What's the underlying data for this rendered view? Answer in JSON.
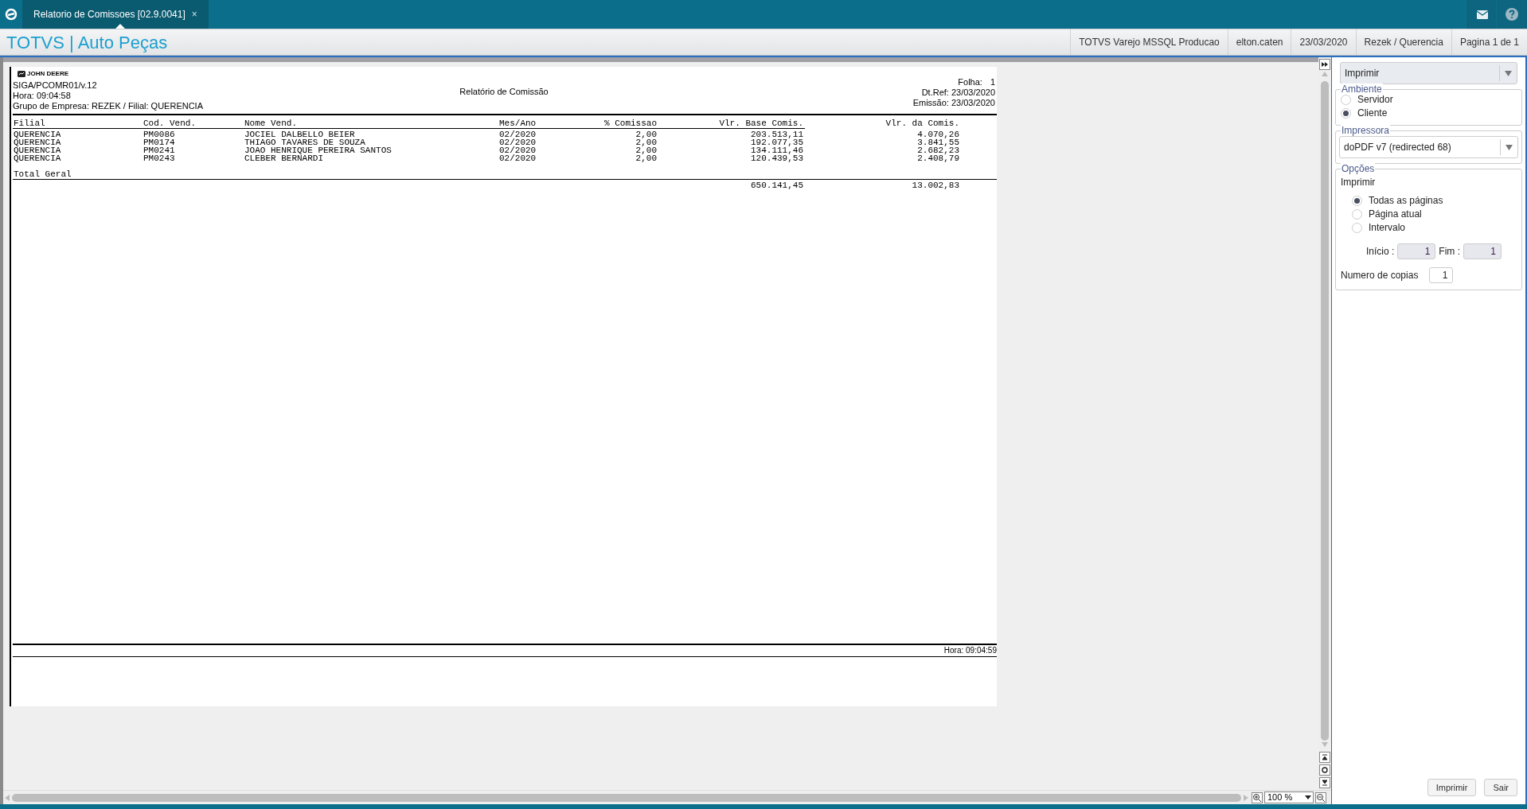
{
  "app_bar": {
    "tab": {
      "label": "Relatorio de Comissoes [02.9.0041]",
      "close": "×",
      "selected": true
    }
  },
  "header": {
    "title": "TOTVS | Auto Peças",
    "info": [
      "TOTVS Varejo MSSQL Producao",
      "elton.caten",
      "23/03/2020",
      "Rezek / Querencia",
      "Pagina 1 de 1"
    ]
  },
  "report": {
    "logo": "JOHN DEERE",
    "program": "SIGA/PCOMR01/v.12",
    "title": "Relatório de Comissão",
    "time": "Hora: 09:04:58",
    "group": "Grupo de Empresa: REZEK / Filial: QUERENCIA",
    "sheet_label": "Folha:",
    "sheet": "1",
    "ref_date": "Dt.Ref: 23/03/2020",
    "issue_date": "Emissão: 23/03/2020",
    "columns": [
      "Filial",
      "Cod. Vend.",
      "Nome Vend.",
      "Mes/Ano",
      "% Comissao",
      "Vlr. Base Comis.",
      "Vlr. da Comis."
    ],
    "rows": [
      [
        "QUERENCIA",
        "PM0086",
        "JOCIEL DALBELLO BEIER",
        "02/2020",
        "2,00",
        "203.513,11",
        "4.070,26"
      ],
      [
        "QUERENCIA",
        "PM0174",
        "THIAGO TAVARES DE SOUZA",
        "02/2020",
        "2,00",
        "192.077,35",
        "3.841,55"
      ],
      [
        "QUERENCIA",
        "PM0241",
        "JOAO HENRIQUE PEREIRA SANTOS",
        "02/2020",
        "2,00",
        "134.111,46",
        "2.682,23"
      ],
      [
        "QUERENCIA",
        "PM0243",
        "CLEBER BERNARDI",
        "02/2020",
        "2,00",
        "120.439,53",
        "2.408,79"
      ]
    ],
    "total_label": "Total Geral",
    "totals": [
      "650.141,45",
      "13.002,83"
    ],
    "footer_time": "Hora: 09:04:59"
  },
  "zoom": "100 %",
  "panel": {
    "action": "Imprimir",
    "ambiente": {
      "title": "Ambiente",
      "options": [
        {
          "label": "Servidor",
          "selected": false
        },
        {
          "label": "Cliente",
          "selected": true
        }
      ]
    },
    "impressora": {
      "title": "Impressora",
      "value": "doPDF v7 (redirected 68)"
    },
    "opcoes": {
      "title": "Opções",
      "subtitle": "Imprimir",
      "options": [
        {
          "label": "Todas as páginas",
          "selected": true
        },
        {
          "label": "Página atual",
          "selected": false
        },
        {
          "label": "Intervalo",
          "selected": false
        }
      ],
      "start_label": "Início :",
      "start": "1",
      "end_label": "Fim :",
      "end": "1",
      "disabled": true,
      "copies_label": "Numero de copias",
      "copies": "1"
    },
    "buttons": [
      "Imprimir",
      "Sair"
    ]
  }
}
